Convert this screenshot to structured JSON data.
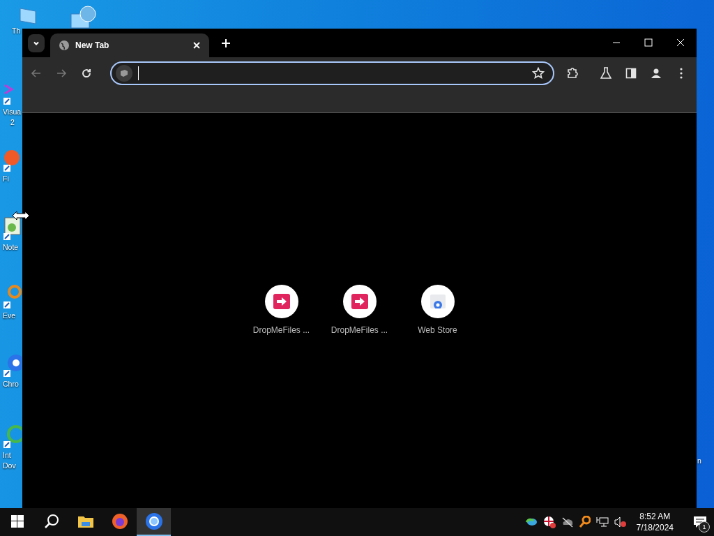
{
  "desktop": {
    "icons": [
      {
        "kind": "pc",
        "lines": [
          "Th"
        ]
      },
      {
        "kind": "network"
      },
      {
        "kind": "vs",
        "lines": [
          "Visua",
          "2"
        ]
      },
      {
        "kind": "firefox",
        "lines": [
          "Fi"
        ]
      },
      {
        "kind": "notepad",
        "lines": [
          "Note"
        ]
      },
      {
        "kind": "everything",
        "lines": [
          "Eve"
        ]
      },
      {
        "kind": "chrome",
        "lines": [
          "Chro"
        ]
      },
      {
        "kind": "idm",
        "lines": [
          "Int",
          "Dov"
        ]
      }
    ],
    "right_label": "n"
  },
  "window": {
    "tabs": [
      {
        "title": "New Tab",
        "selected": true
      }
    ],
    "omnibox": {
      "focused": true
    },
    "shortcuts": [
      {
        "title": "DropMeFiles ...",
        "kind": "dropmefiles"
      },
      {
        "title": "DropMeFiles ...",
        "kind": "dropmefiles"
      },
      {
        "title": "Web Store",
        "kind": "webstore"
      }
    ]
  },
  "taskbar": {
    "apps": [
      {
        "kind": "explorer",
        "selected": false
      },
      {
        "kind": "firefox",
        "selected": false
      },
      {
        "kind": "chrome",
        "selected": true
      }
    ],
    "time": "8:52 AM",
    "date": "7/18/2024",
    "notifications": "1"
  }
}
